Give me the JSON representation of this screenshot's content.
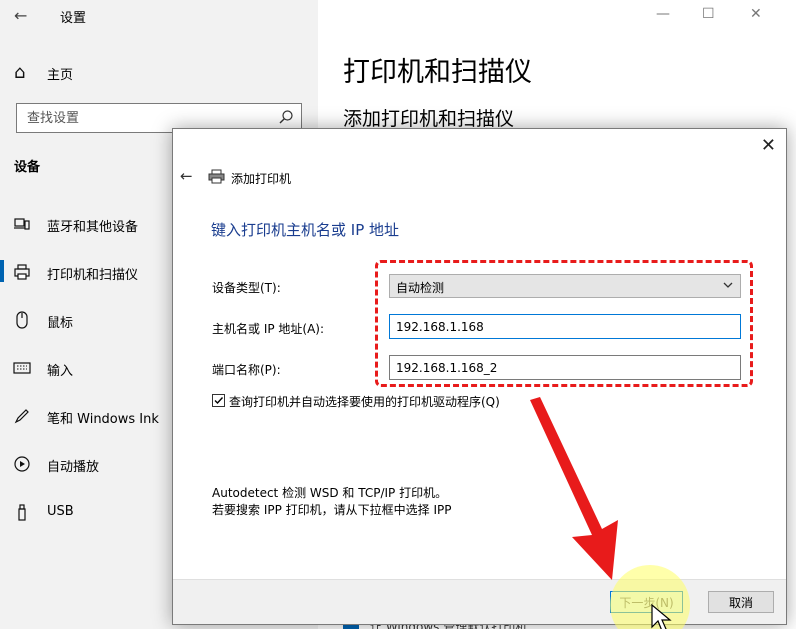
{
  "window": {
    "title": "设置",
    "controls": {
      "minimize": "—",
      "maximize": "☐",
      "close": "✕"
    }
  },
  "sidebar": {
    "home_label": "主页",
    "search_placeholder": "查找设置",
    "section_title": "设备",
    "items": [
      {
        "label": "蓝牙和其他设备",
        "icon": "bluetooth-icon"
      },
      {
        "label": "打印机和扫描仪",
        "icon": "printer-icon",
        "active": true
      },
      {
        "label": "鼠标",
        "icon": "mouse-icon"
      },
      {
        "label": "输入",
        "icon": "keyboard-icon"
      },
      {
        "label": "笔和 Windows Ink",
        "icon": "pen-icon"
      },
      {
        "label": "自动播放",
        "icon": "autoplay-icon"
      },
      {
        "label": "USB",
        "icon": "usb-icon"
      }
    ]
  },
  "main": {
    "title": "打印机和扫描仪",
    "subtitle": "添加打印机和扫描仪",
    "bottom_checkbox_text": "让 Windows 管理默认打印机"
  },
  "dialog": {
    "title": "添加打印机",
    "heading": "键入打印机主机名或 IP 地址",
    "device_type_label": "设备类型(T):",
    "device_type_value": "自动检测",
    "host_label": "主机名或 IP 地址(A):",
    "host_value": "192.168.1.168",
    "port_label": "端口名称(P):",
    "port_value": "192.168.1.168_2",
    "query_checkbox_label": "查询打印机并自动选择要使用的打印机驱动程序(Q)",
    "query_checked": true,
    "info_line1": "Autodetect 检测 WSD 和 TCP/IP 打印机。",
    "info_line2": "若要搜索 IPP 打印机，请从下拉框中选择 IPP",
    "next_button": "下一步(N)",
    "cancel_button": "取消"
  },
  "colors": {
    "accent": "#0063b1",
    "heading_blue": "#1a3d8f",
    "annotation_red": "#e81b1b"
  }
}
